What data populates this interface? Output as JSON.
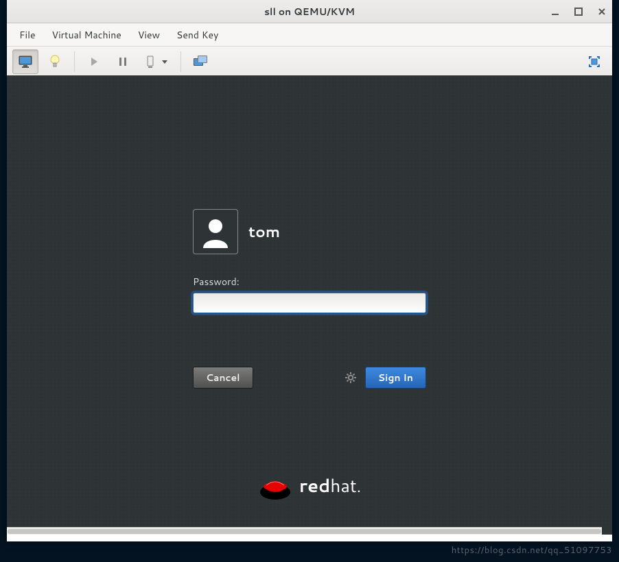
{
  "window": {
    "title": "sll on QEMU/KVM"
  },
  "menu": {
    "file": "File",
    "vm": "Virtual Machine",
    "view": "View",
    "sendkey": "Send Key"
  },
  "toolbar": {
    "icons": {
      "console": "console-icon",
      "info": "lightbulb-icon",
      "run": "play-icon",
      "pause": "pause-icon",
      "shutdown": "power-icon",
      "dropdown": "dropdown-icon",
      "snapshot": "snapshot-icon",
      "fullscreen": "fullscreen-icon"
    }
  },
  "login": {
    "username": "tom",
    "password_label": "Password:",
    "password_value": "",
    "cancel": "Cancel",
    "signin": "Sign In"
  },
  "branding": {
    "name_bold": "red",
    "name_light": "hat",
    "suffix": "."
  },
  "watermark": "https://blog.csdn.net/qq_51097753"
}
